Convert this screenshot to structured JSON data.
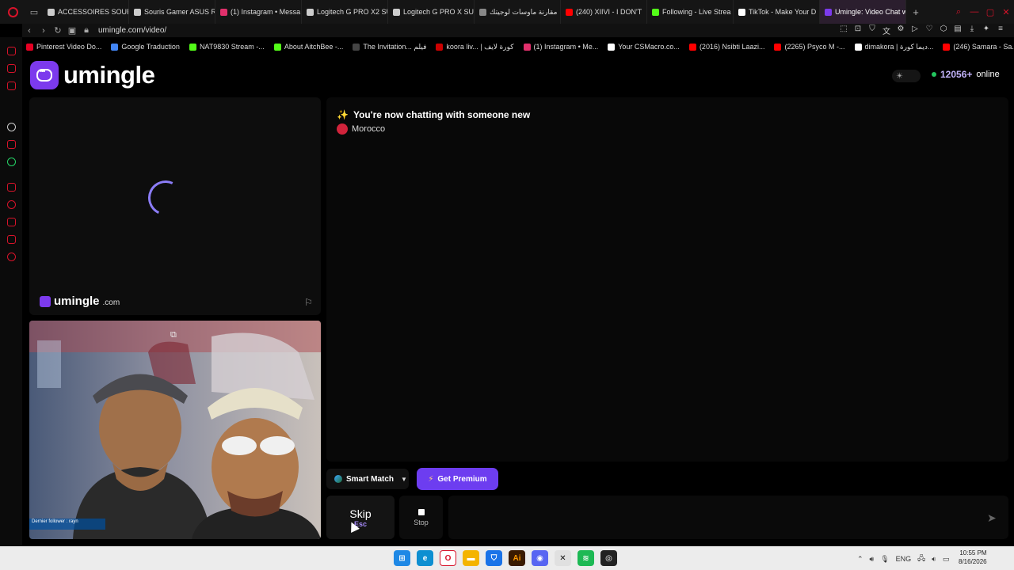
{
  "browser": {
    "tabs": [
      {
        "label": "ACCESSOIRES SOURI",
        "color": "#cccccc"
      },
      {
        "label": "Souris Gamer ASUS R",
        "color": "#cccccc"
      },
      {
        "label": "(1) Instagram • Messa",
        "color": "#e1306c"
      },
      {
        "label": "Logitech G PRO X2 SU",
        "color": "#cccccc"
      },
      {
        "label": "Logitech G PRO X SU",
        "color": "#cccccc"
      },
      {
        "label": "مقارنة ماوسات لوجيتك",
        "color": "#888888"
      },
      {
        "label": "(240) XIIVI - I DON'T",
        "color": "#ff0000"
      },
      {
        "label": "Following - Live Strea",
        "color": "#53fc18"
      },
      {
        "label": "TikTok - Make Your D",
        "color": "#ffffff"
      },
      {
        "label": "Umingle: Video Chat w",
        "color": "#7c3aed"
      }
    ],
    "url": "umingle.com/video/",
    "bookmarks": [
      {
        "label": "Pinterest Video Do...",
        "color": "#e60023"
      },
      {
        "label": "Google Traduction",
        "color": "#4285f4"
      },
      {
        "label": "NAT9830 Stream -...",
        "color": "#53fc18"
      },
      {
        "label": "About AitchBee -...",
        "color": "#53fc18"
      },
      {
        "label": "The Invitation... فيلم",
        "color": "#444444"
      },
      {
        "label": "koora liv... | كورة لايف",
        "color": "#cc0000"
      },
      {
        "label": "(1) Instagram • Me...",
        "color": "#e1306c"
      },
      {
        "label": "Your CSMacro.co...",
        "color": "#ffffff"
      },
      {
        "label": "(2016) Nsibti Laazi...",
        "color": "#ff0000"
      },
      {
        "label": "(2265) Psyco M -...",
        "color": "#ff0000"
      },
      {
        "label": "dimakora | ديما كورة...",
        "color": "#ffffff"
      },
      {
        "label": "(246) Samara - Sa...",
        "color": "#ff0000"
      }
    ]
  },
  "site": {
    "logo_text": "umingle",
    "watermark_name": "umingle",
    "watermark_tld": ".com",
    "online_count": "12056+",
    "online_label": "online",
    "accent": "#7c3aed"
  },
  "chat": {
    "spark": "✨",
    "title": "You're now chatting with someone new",
    "country": "Morocco",
    "message_placeholder": ""
  },
  "controls": {
    "smart_match": "Smart Match",
    "premium": "Get Premium",
    "skip_label": "Skip",
    "skip_key": "Esc",
    "stop_label": "Stop"
  },
  "self_video": {
    "overlay_text": "Dernier follower : rayn"
  },
  "taskbar": {
    "language": "ENG",
    "time": "10:55 PM",
    "date": "8/16/2026"
  }
}
